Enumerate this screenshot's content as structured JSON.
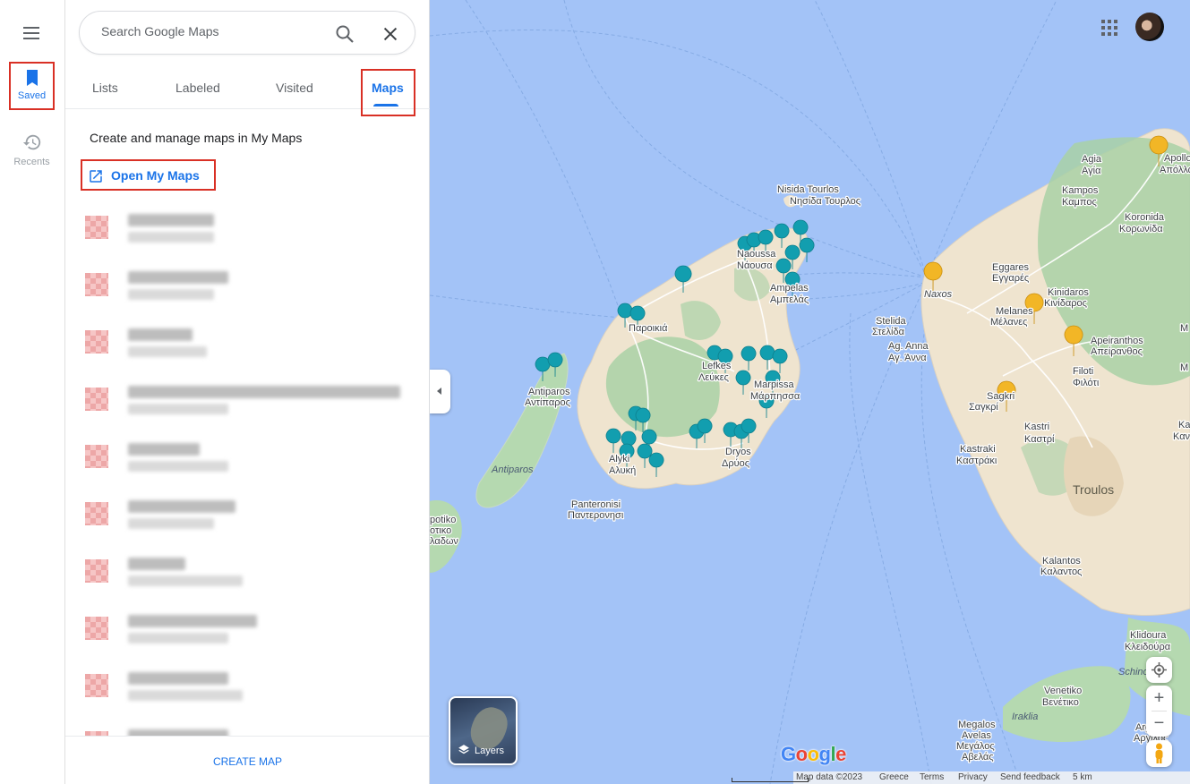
{
  "rail": {
    "menu_icon": "hamburger-menu-icon",
    "items": [
      {
        "label": "Saved",
        "icon": "bookmark-icon",
        "active": true
      },
      {
        "label": "Recents",
        "icon": "history-icon",
        "active": false
      }
    ]
  },
  "search": {
    "placeholder": "Search Google Maps",
    "value": "",
    "search_icon": "search-icon",
    "close_icon": "close-icon"
  },
  "tabs": [
    {
      "label": "Lists",
      "active": false
    },
    {
      "label": "Labeled",
      "active": false
    },
    {
      "label": "Visited",
      "active": false
    },
    {
      "label": "Maps",
      "active": true
    }
  ],
  "maps_panel": {
    "description": "Create and manage maps in My Maps",
    "open_link": "Open My Maps",
    "open_icon": "open-in-new-icon",
    "items_redacted": true,
    "item_count_visible": 10,
    "create_button": "CREATE MAP"
  },
  "map": {
    "labels": {
      "nisida_tourlos": "Nisida Tourlos",
      "nisida_tourlos_gr": "Νησίδα Τουρλος",
      "naoussa": "Naoussa",
      "naoussa_gr": "Νάουσα",
      "ampelas": "Ampelas",
      "ampelas_gr": "Αμπελάς",
      "parikia_gr": "Παροικιά",
      "antiparos": "Antiparos",
      "antiparos_gr": "Αντίπαρος",
      "antiparos_island": "Antiparos",
      "lefkes": "Lefkes",
      "lefkes_gr": "Λεύκες",
      "marpissa": "Marpissa",
      "marpissa_gr": "Μάρπησσα",
      "dryos": "Dryos",
      "dryos_gr": "Δρύος",
      "alyki": "Alyki",
      "alyki_gr": "Αλυκή",
      "panteronisi": "Panteronisi",
      "panteronisi_gr": "Παντερονησι",
      "despotiko": "potiko",
      "despotiko_gr1": "οτικο",
      "despotiko_gr2": "λαδων",
      "agia": "Agia",
      "agia_gr": "Αγία",
      "apollonas": "Apollonas",
      "apollonas_gr": "Απόλλωνας",
      "kampos": "Kampos",
      "kampos_gr": "Καμπος",
      "koronida": "Koronida",
      "koronida_gr": "Κορωνίδα",
      "naxos": "Naxos",
      "eggares": "Eggares",
      "eggares_gr": "Εγγαρές",
      "stelida": "Stelida",
      "stelida_gr": "Στελίδα",
      "agia_anna": "Ag. Anna",
      "agia_anna_gr": "Αγ. Άννα",
      "melanes": "Melanes",
      "melanes_gr": "Μέλανες",
      "kinidaros": "Kinidaros",
      "kinidaros_gr": "Κινίδαρος",
      "apeiranthos": "Apeiranthos",
      "apeiranthos_gr": "Απείρανθος",
      "filoti": "Filoti",
      "filoti_gr": "Φιλότι",
      "sagkri": "Sagkri",
      "sagkri_gr": "Σαγκρί",
      "kastri": "Kastri",
      "kastri_gr": "Καστρί",
      "kastraki": "Kastraki",
      "kastraki_gr": "Καστράκι",
      "troulos": "Troulos",
      "kalantos": "Kalantos",
      "kalantos_gr": "Καλαντος",
      "kleidoura": "Klidoura",
      "kleidoura_gr": "Κλειδούρα",
      "schinousa": "Schinous",
      "venetiko": "Venetiko",
      "venetiko_gr": "Βενέτικο",
      "iraklia": "Iraklia",
      "megalos": "Megalos",
      "megalos2": "Avelas",
      "megalos_gr": "Μεγάλος",
      "megalos_gr2": "Αβελάς",
      "argilos": "Argilos",
      "argilos_gr": "Αργιλος",
      "m_edge": "M",
      "m_edge2": "M",
      "ka_edge": "Ka",
      "ka_edge2": "Καν"
    },
    "layers_label": "Layers",
    "layers_icon": "layers-icon",
    "my_location_icon": "my-location-icon",
    "zoom_in": "+",
    "zoom_out": "−",
    "pegman_icon": "pegman-icon",
    "apps_icon": "apps-grid-icon",
    "avatar": "user-avatar",
    "logo": "Google",
    "attribution": {
      "map_data": "Map data ©2023",
      "region": "Greece",
      "terms": "Terms",
      "privacy": "Privacy",
      "feedback": "Send feedback",
      "scale": "5 km"
    },
    "colors": {
      "sea": "#a3c3f7",
      "land": "#f2eadc",
      "green": "#b9dcb4",
      "teal_pin": "#129eaf",
      "gold_star": "#f2b626"
    }
  }
}
